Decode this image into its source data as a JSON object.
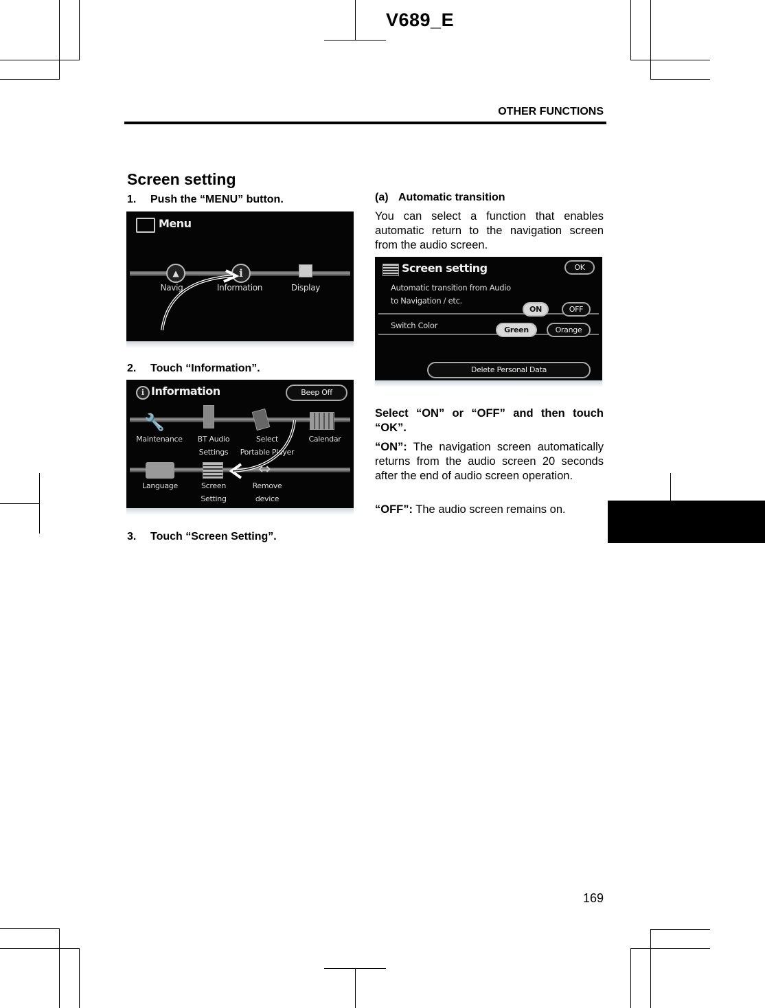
{
  "doc_code": "V689_E",
  "section_header": "OTHER FUNCTIONS",
  "page_number": "169",
  "title": "Screen setting",
  "steps": [
    {
      "num": "1.",
      "text": "Push the “MENU” button."
    },
    {
      "num": "2.",
      "text": "Touch “Information”."
    },
    {
      "num": "3.",
      "text": "Touch “Screen Setting”."
    }
  ],
  "menu_screen": {
    "title": "Menu",
    "items": [
      {
        "label": "Navigation",
        "visible_label": "Navig",
        "icon": "compass-icon"
      },
      {
        "label": "Information",
        "icon": "info-icon"
      },
      {
        "label": "Display",
        "icon": "display-icon"
      }
    ]
  },
  "info_screen": {
    "title": "Information",
    "beep_button": "Beep Off",
    "items": [
      {
        "line1": "Maintenance",
        "line2": "",
        "icon": "wrench-icon"
      },
      {
        "line1": "BT Audio",
        "line2": "Settings",
        "icon": "phone-icon"
      },
      {
        "line1": "Select",
        "line2": "Portable Player",
        "icon": "player-icon"
      },
      {
        "line1": "Calendar",
        "line2": "",
        "icon": "calendar-icon"
      },
      {
        "line1": "Language",
        "line2": "",
        "icon": "book-icon"
      },
      {
        "line1": "Screen",
        "line2": "Setting",
        "icon": "screen-setting-icon"
      },
      {
        "line1": "Remove",
        "line2": "device",
        "icon": "remove-device-icon"
      }
    ]
  },
  "screen_setting_screen": {
    "title": "Screen setting",
    "ok_button": "OK",
    "transition_label_1": "Automatic transition from Audio",
    "transition_label_2": "to Navigation / etc.",
    "on_button": "ON",
    "off_button": "OFF",
    "transition_selected": "ON",
    "switch_color_label": "Switch Color",
    "green_button": "Green",
    "orange_button": "Orange",
    "color_selected": "Green",
    "delete_button": "Delete Personal Data"
  },
  "subsection": {
    "label": "(a)",
    "title": "Automatic transition",
    "intro": "You can select a function that enables automatic return to the navigation screen from the audio screen.",
    "instruction": "Select “ON” or “OFF” and then touch “OK”.",
    "on_term": "“ON”:",
    "on_desc": "The navigation screen automatically returns from the audio screen 20 seconds after the end of audio screen operation.",
    "off_term": "“OFF”:",
    "off_desc": "The audio screen remains on."
  }
}
